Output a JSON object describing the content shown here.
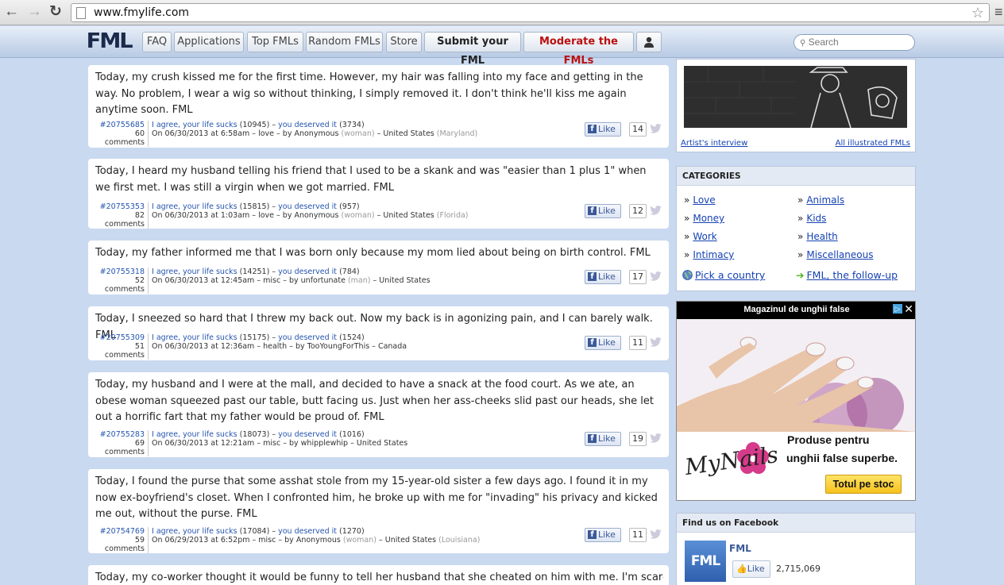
{
  "browser": {
    "url": "www.fmylife.com"
  },
  "nav": {
    "logo": "FML",
    "items": [
      "FAQ",
      "Applications",
      "Top FMLs",
      "Random FMLs",
      "Store",
      "Submit your FML",
      "Moderate the FMLs"
    ],
    "search_placeholder": "Search"
  },
  "posts": [
    {
      "text": "Today, my crush kissed me for the first time. However, my hair was falling into my face and getting in the way. No problem, I wear a wig so without thinking, I simply removed it. I don't think he'll kiss me again anytime soon. FML",
      "id": "#20755685",
      "agree": "I agree, your life sucks",
      "agree_count": "(10945)",
      "deserved": "you deserved it",
      "deserved_count": "(3734)",
      "comments": "60 comments",
      "date": "On 06/30/2013 at 6:58am",
      "category": "love",
      "author": "Anonymous",
      "gender": "(woman)",
      "location": "United States",
      "region": "(Maryland)",
      "likes": "14"
    },
    {
      "text": "Today, I heard my husband telling his friend that I used to be a skank and was \"easier than 1 plus 1\" when we first met. I was still a virgin when we got married. FML",
      "id": "#20755353",
      "agree": "I agree, your life sucks",
      "agree_count": "(15815)",
      "deserved": "you deserved it",
      "deserved_count": "(957)",
      "comments": "82 comments",
      "date": "On 06/30/2013 at 1:03am",
      "category": "love",
      "author": "Anonymous",
      "gender": "(woman)",
      "location": "United States",
      "region": "(Florida)",
      "likes": "12"
    },
    {
      "text": "Today, my father informed me that I was born only because my mom lied about being on birth control. FML",
      "id": "#20755318",
      "agree": "I agree, your life sucks",
      "agree_count": "(14251)",
      "deserved": "you deserved it",
      "deserved_count": "(784)",
      "comments": "52 comments",
      "date": "On 06/30/2013 at 12:45am",
      "category": "misc",
      "author": "unfortunate",
      "gender": "(man)",
      "location": "United States",
      "region": "",
      "likes": "17"
    },
    {
      "text": "Today, I sneezed so hard that I threw my back out. Now my back is in agonizing pain, and I can barely walk. FML",
      "id": "#20755309",
      "agree": "I agree, your life sucks",
      "agree_count": "(15175)",
      "deserved": "you deserved it",
      "deserved_count": "(1524)",
      "comments": "51 comments",
      "date": "On 06/30/2013 at 12:36am",
      "category": "health",
      "author": "TooYoungForThis",
      "gender": "",
      "location": "Canada",
      "region": "",
      "likes": "11"
    },
    {
      "text": "Today, my husband and I were at the mall, and decided to have a snack at the food court. As we ate, an obese woman squeezed past our table, butt facing us. Just when her ass-cheeks slid past our heads, she let out a horrific fart that my father would be proud of. FML",
      "id": "#20755283",
      "agree": "I agree, your life sucks",
      "agree_count": "(18073)",
      "deserved": "you deserved it",
      "deserved_count": "(1016)",
      "comments": "69 comments",
      "date": "On 06/30/2013 at 12:21am",
      "category": "misc",
      "author": "whipplewhip",
      "gender": "",
      "location": "United States",
      "region": "",
      "likes": "19"
    },
    {
      "text": "Today, I found the purse that some asshat stole from my 15-year-old sister a few days ago. I found it in my now ex-boyfriend's closet. When I confronted him, he broke up with me for \"invading\" his privacy and kicked me out, without the purse. FML",
      "id": "#20754769",
      "agree": "I agree, your life sucks",
      "agree_count": "(17084)",
      "deserved": "you deserved it",
      "deserved_count": "(1270)",
      "comments": "59 comments",
      "date": "On 06/29/2013 at 6:52pm",
      "category": "misc",
      "author": "Anonymous",
      "gender": "(woman)",
      "location": "United States",
      "region": "(Louisiana)",
      "likes": "11"
    },
    {
      "text": "Today, my co-worker thought it would be funny to tell her husband that she cheated on him with me. I'm scared"
    }
  ],
  "like_label": "Like",
  "sidebar": {
    "artist_link": "Artist's interview",
    "illustrated_link": "All illustrated FMLs",
    "categories_title": "CATEGORIES",
    "categories_left": [
      "Love",
      "Money",
      "Work",
      "Intimacy"
    ],
    "categories_right": [
      "Animals",
      "Kids",
      "Health",
      "Miscellaneous"
    ],
    "pick_country": "Pick a country",
    "follow_up": "FML, the follow-up",
    "ad": {
      "title": "Magazinul de unghii false",
      "logo": "MyNails",
      "line1": "Produse pentru",
      "line2": "unghii false superbe.",
      "button": "Totul pe stoc"
    },
    "facebook": {
      "title": "Find us on Facebook",
      "page": "FML",
      "like": "Like",
      "count": "2,715,069"
    }
  }
}
